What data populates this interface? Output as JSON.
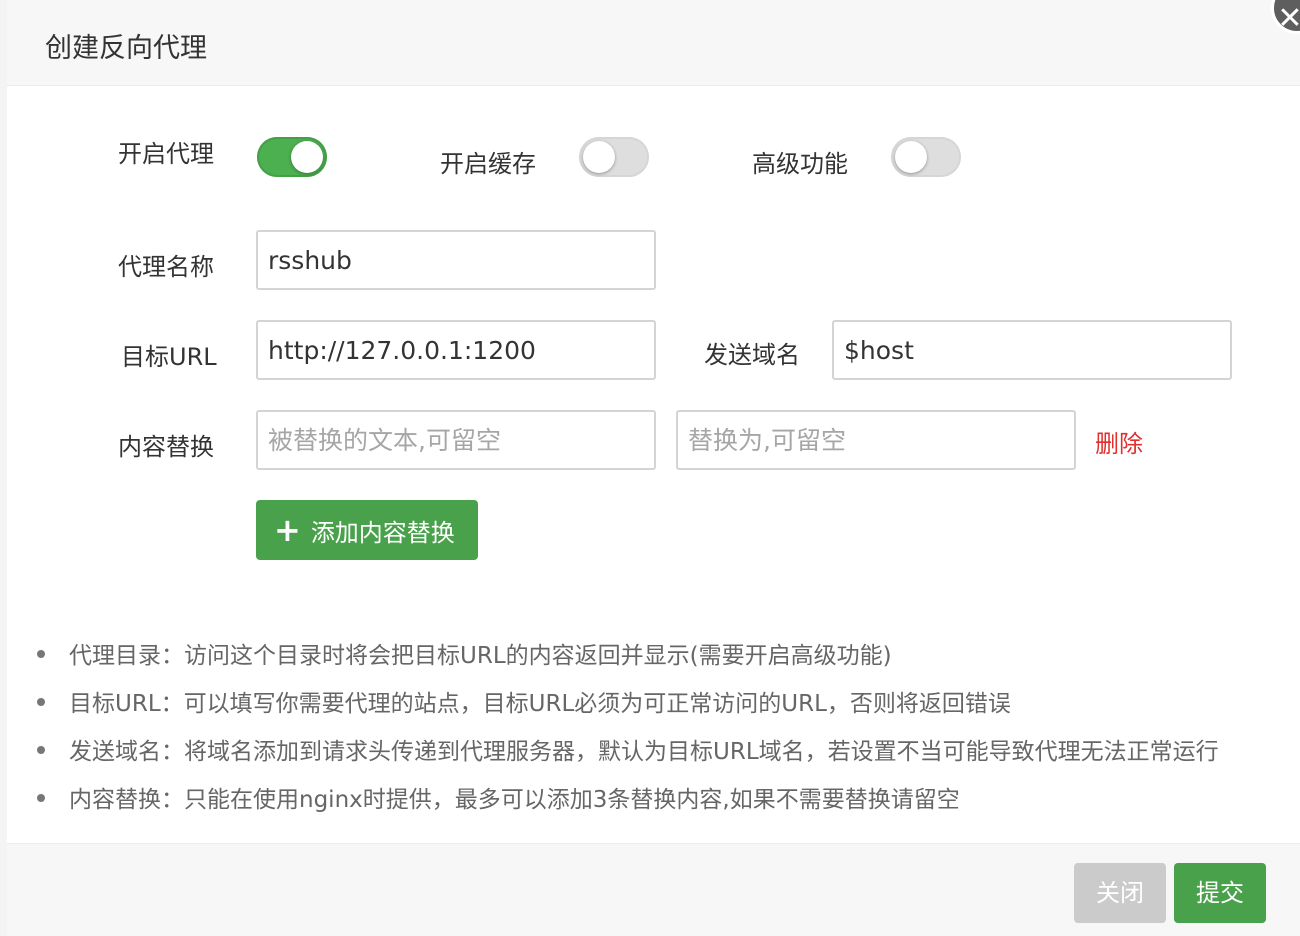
{
  "dialog": {
    "title": "创建反向代理",
    "close_icon": "close-icon"
  },
  "toggles": {
    "proxy": {
      "label": "开启代理",
      "on": true
    },
    "cache": {
      "label": "开启缓存",
      "on": false
    },
    "advanced": {
      "label": "高级功能",
      "on": false
    }
  },
  "form": {
    "name": {
      "label": "代理名称",
      "value": "rsshub"
    },
    "target": {
      "label": "目标URL",
      "value": "http://127.0.0.1:1200"
    },
    "host": {
      "label": "发送域名",
      "value": "$host"
    },
    "replace": {
      "label": "内容替换",
      "from_placeholder": "被替换的文本,可留空",
      "to_placeholder": "替换为,可留空",
      "delete_label": "删除"
    },
    "add_replace_label": "添加内容替换"
  },
  "tips": [
    "代理目录：访问这个目录时将会把目标URL的内容返回并显示(需要开启高级功能)",
    "目标URL：可以填写你需要代理的站点，目标URL必须为可正常访问的URL，否则将返回错误",
    "发送域名：将域名添加到请求头传递到代理服务器，默认为目标URL域名，若设置不当可能导致代理无法正常运行",
    "内容替换：只能在使用nginx时提供，最多可以添加3条替换内容,如果不需要替换请留空"
  ],
  "footer": {
    "close_label": "关闭",
    "submit_label": "提交"
  },
  "colors": {
    "accent_green": "#4aa14c",
    "danger_red": "#e02f2f",
    "disabled_gray": "#cbcbcb"
  }
}
